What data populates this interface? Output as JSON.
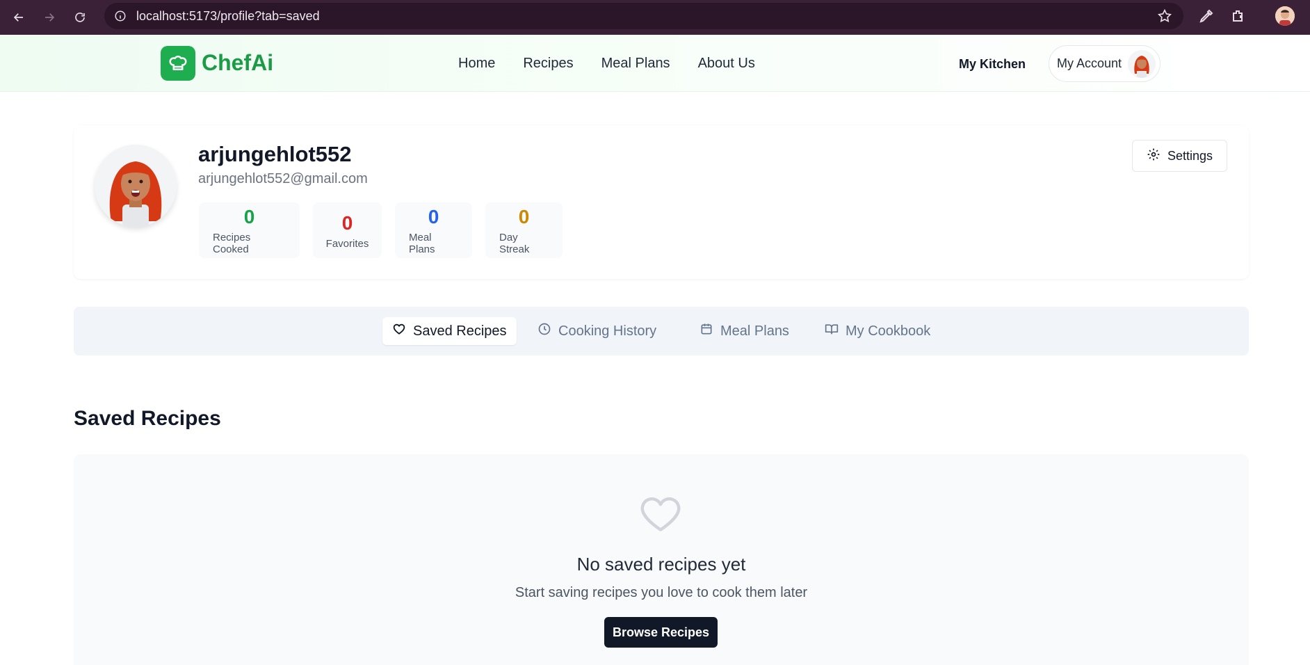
{
  "browser": {
    "url": "localhost:5173/profile?tab=saved"
  },
  "header": {
    "logo_text": "ChefAi",
    "nav": [
      "Home",
      "Recipes",
      "Meal Plans",
      "About Us"
    ],
    "my_kitchen": "My Kitchen",
    "account_label": "My Account"
  },
  "profile": {
    "username": "arjungehlot552",
    "email": "arjungehlot552@gmail.com",
    "settings_label": "Settings",
    "stats": [
      {
        "value": "0",
        "label": "Recipes Cooked",
        "color": "#16a34a"
      },
      {
        "value": "0",
        "label": "Favorites",
        "color": "#dc2626"
      },
      {
        "value": "0",
        "label": "Meal Plans",
        "color": "#2563eb"
      },
      {
        "value": "0",
        "label": "Day Streak",
        "color": "#ca8a04"
      }
    ]
  },
  "tabs": [
    {
      "label": "Saved Recipes",
      "icon": "heart-icon",
      "active": true
    },
    {
      "label": "Cooking History",
      "icon": "clock-icon",
      "active": false
    },
    {
      "label": "Meal Plans",
      "icon": "calendar-icon",
      "active": false
    },
    {
      "label": "My Cookbook",
      "icon": "book-open-icon",
      "active": false
    }
  ],
  "saved": {
    "title": "Saved Recipes",
    "empty_title": "No saved recipes yet",
    "empty_subtitle": "Start saving recipes you love to cook them later",
    "browse_label": "Browse Recipes"
  },
  "colors": {
    "brand_green": "#1fae4f",
    "dark_button": "#111827"
  }
}
